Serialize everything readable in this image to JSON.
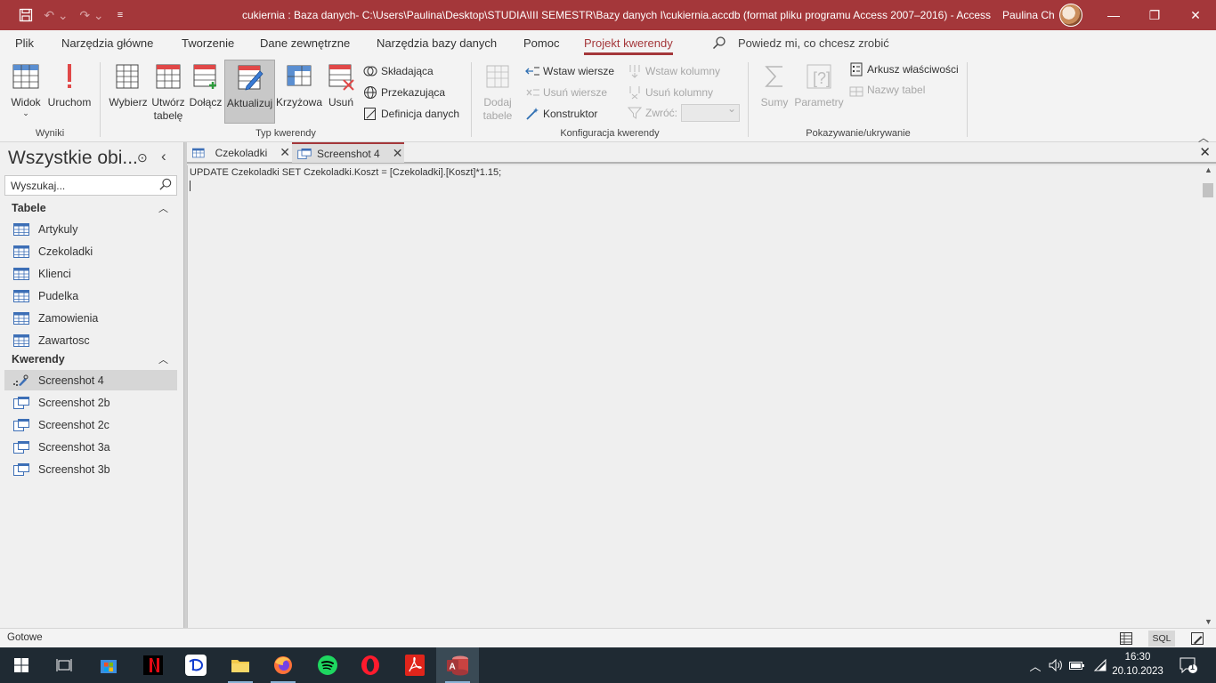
{
  "window": {
    "title": "cukiernia : Baza danych- C:\\Users\\Paulina\\Desktop\\STUDIA\\III SEMESTR\\Bazy danych I\\cukiernia.accdb (format pliku programu Access 2007–2016)  -  Access",
    "user": "Paulina Ch"
  },
  "quick_access": {
    "save_icon": "save-icon",
    "undo_icon": "undo-icon",
    "redo_icon": "redo-icon",
    "customize_icon": "customize-icon"
  },
  "ribbon_tabs": [
    "Plik",
    "Narzędzia główne",
    "Tworzenie",
    "Dane zewnętrzne",
    "Narzędzia bazy danych",
    "Pomoc",
    "Projekt kwerendy"
  ],
  "tell_me": "Powiedz mi, co chcesz zrobić",
  "ribbon": {
    "wyniki": {
      "label": "Wyniki",
      "widok": "Widok",
      "uruchom": "Uruchom"
    },
    "typ_kwerendy": {
      "label": "Typ kwerendy",
      "wybierz": "Wybierz",
      "utworz_tabele_1": "Utwórz",
      "utworz_tabele_2": "tabelę",
      "dolacz": "Dołącz",
      "aktualizuj": "Aktualizuj",
      "krzyzowa": "Krzyżowa",
      "usun": "Usuń",
      "skladajaca": "Składająca",
      "przekazujaca": "Przekazująca",
      "definicja_danych": "Definicja danych"
    },
    "konfiguracja": {
      "label": "Konfiguracja kwerendy",
      "dodaj_tabele_1": "Dodaj",
      "dodaj_tabele_2": "tabele",
      "wstaw_wiersze": "Wstaw wiersze",
      "usun_wiersze": "Usuń wiersze",
      "konstruktor": "Konstruktor",
      "wstaw_kolumny": "Wstaw kolumny",
      "usun_kolumny": "Usuń kolumny",
      "zwroc": "Zwróć:"
    },
    "pokazywanie": {
      "label": "Pokazywanie/ukrywanie",
      "sumy": "Sumy",
      "parametry": "Parametry",
      "arkusz_wlasciwosci": "Arkusz właściwości",
      "nazwy_tabel": "Nazwy tabel"
    }
  },
  "nav": {
    "title": "Wszystkie obi...",
    "search_placeholder": "Wyszukaj...",
    "tables_header": "Tabele",
    "tables": [
      "Artykuly",
      "Czekoladki",
      "Klienci",
      "Pudelka",
      "Zamowienia",
      "Zawartosc"
    ],
    "queries_header": "Kwerendy",
    "queries": [
      "Screenshot 4",
      "Screenshot 2b",
      "Screenshot 2c",
      "Screenshot 3a",
      "Screenshot 3b"
    ]
  },
  "doc_tabs": [
    {
      "label": "Czekoladki"
    },
    {
      "label": "Screenshot 4"
    }
  ],
  "sql_text": "UPDATE Czekoladki SET Czekoladki.Koszt = [Czekoladki].[Koszt]*1.15;",
  "status": {
    "text": "Gotowe",
    "sql_view": "SQL"
  },
  "taskbar": {
    "time": "16:30",
    "date": "20.10.2023",
    "notifications": "1"
  },
  "colors": {
    "accent": "#a4373a",
    "taskbar": "#1f2a33"
  }
}
